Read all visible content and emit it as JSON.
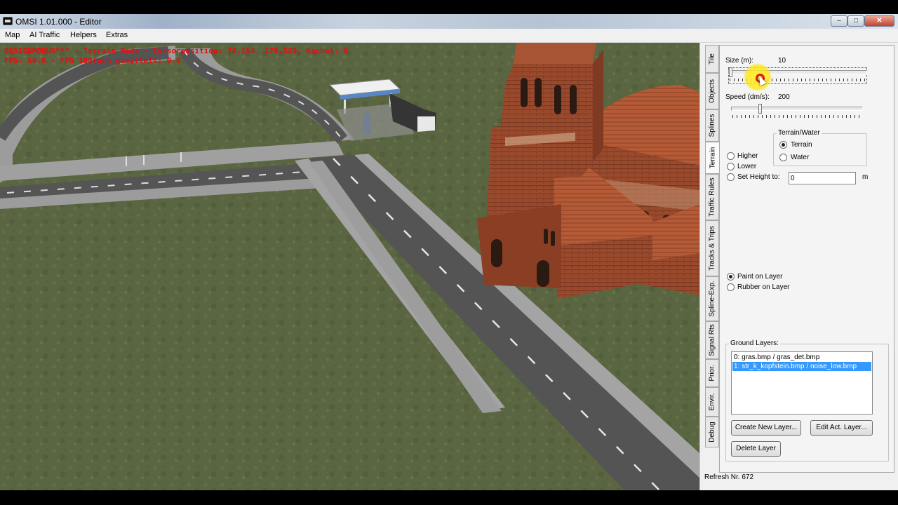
{
  "window": {
    "title": "OMSI 1.01.000 - Editor",
    "btn_min": "–",
    "btn_max": "□",
    "btn_close": "✕"
  },
  "menu": [
    "Map",
    "AI Traffic",
    "Helpers",
    "Extras"
  ],
  "hud": {
    "line1": "DESIGNMODUS*** - Terrain Mode - Cursorposition: 74.154, 179.520, Kachel: 0",
    "line2": "FPS: 50.0 - FPS 100fach gemittelt: 0.0"
  },
  "tabs": [
    "Tile",
    "Objects",
    "Splines",
    "Terrain",
    "Traffic Rules",
    "Tracks & Trips",
    "Spline-Exp.",
    "Signal Rts",
    "Prior.",
    "Envir.",
    "Debug"
  ],
  "active_tab": "Terrain",
  "terrain": {
    "size_label": "Size (m):",
    "size_value": "10",
    "speed_label": "Speed (dm/s):",
    "speed_value": "200",
    "mode_options": [
      "Higher",
      "Lower",
      "Set Height to:"
    ],
    "set_height_value": "0",
    "set_height_unit": "m",
    "target_group_label": "Terrain/Water",
    "target_options": [
      "Terrain",
      "Water"
    ],
    "target_selected": "Terrain",
    "paint_options": [
      "Paint on Layer",
      "Rubber on Layer"
    ],
    "paint_selected": "Paint on Layer",
    "ground_layers_label": "Ground Layers:",
    "ground_layers": [
      "0: gras.bmp / gras_det.bmp",
      "1: str_k_kopfstein.bmp / noise_low.bmp"
    ],
    "selected_layer_index": 1,
    "buttons": {
      "create_layer": "Create New Layer...",
      "edit_layer": "Edit Act. Layer...",
      "delete_layer": "Delete Layer"
    }
  },
  "status": {
    "refresh": "Refresh Nr. 672"
  }
}
